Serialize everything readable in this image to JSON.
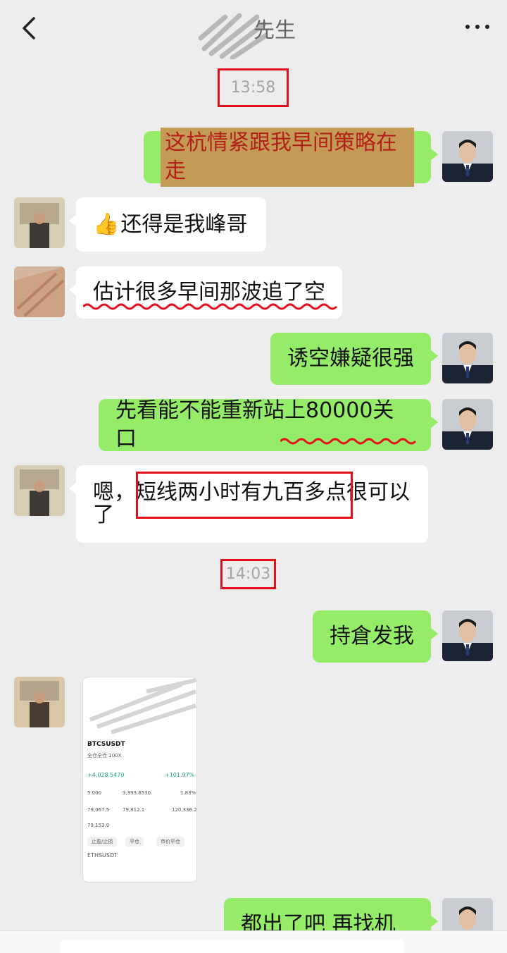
{
  "header": {
    "title": "先生"
  },
  "timestamps": [
    "13:58",
    "14:03"
  ],
  "messages": [
    {
      "from": "me",
      "text": "这杭情紧跟我早间策略在走"
    },
    {
      "from": "them",
      "emoji": "👍",
      "text": "还得是我峰哥"
    },
    {
      "from": "them",
      "text": "估计很多早间那波追了空"
    },
    {
      "from": "me",
      "text": "诱空嫌疑很强"
    },
    {
      "from": "me",
      "text": "先看能不能重新站上80000关口"
    },
    {
      "from": "them",
      "line1": "嗯，短线两小时有九百多点很可以",
      "line2": "了"
    },
    {
      "from": "me",
      "text": "持倉发我"
    },
    {
      "from": "them",
      "type": "image"
    },
    {
      "from": "me",
      "text": "都出了吧 再找机会"
    }
  ],
  "thumb": {
    "symbol": "BTCSUSDT",
    "tag1": "全仓全仓",
    "tag2": "100X",
    "pnl": "+4,028.5470",
    "roe": "+101.97%",
    "c1": "5.000",
    "c2": "3,393.6530",
    "c3": "1.83%",
    "d1": "79,067.5",
    "d2": "79,812.1",
    "d3": "120,336.2",
    "e1": "79,153.9",
    "btn1": "止盈/止损",
    "btn2": "平仓",
    "btn3": "市价平仓",
    "sym2": "ETHSUSDT"
  },
  "colors": {
    "background": "#ededed",
    "me_bubble": "#95ec69",
    "them_bubble": "#ffffff",
    "annotation": "#e3101a"
  }
}
